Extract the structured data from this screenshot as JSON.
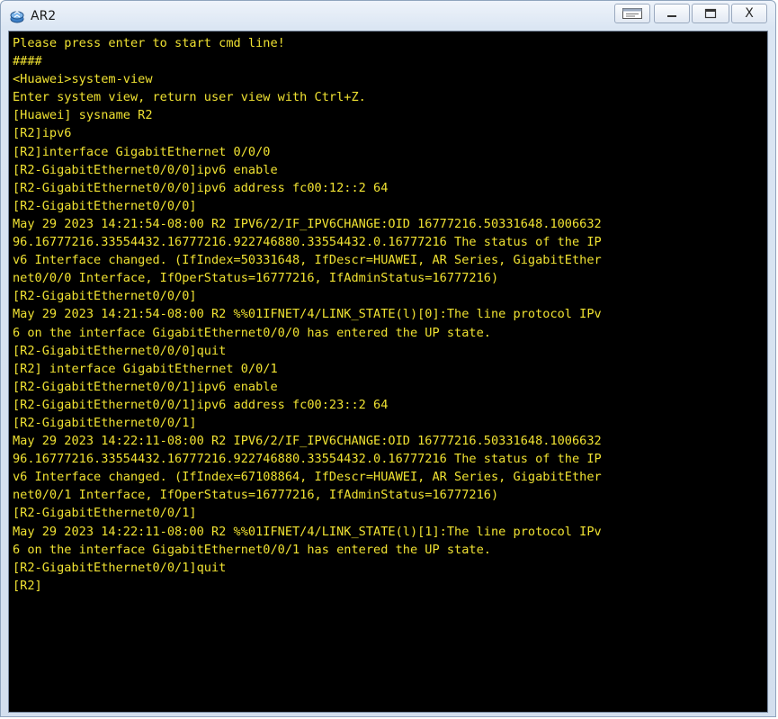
{
  "window": {
    "title": "AR2"
  },
  "controls": {
    "restore_icon": "window-switch-icon",
    "minimize_icon": "minimize-icon",
    "maximize_icon": "maximize-icon",
    "close_label": "X"
  },
  "colors": {
    "terminal_background": "#000000",
    "terminal_text": "#f0e232"
  },
  "terminal": {
    "lines": [
      "Please press enter to start cmd line!",
      "####",
      "<Huawei>system-view",
      "Enter system view, return user view with Ctrl+Z.",
      "[Huawei] sysname R2",
      "[R2]ipv6",
      "[R2]interface GigabitEthernet 0/0/0",
      "[R2-GigabitEthernet0/0/0]ipv6 enable",
      "[R2-GigabitEthernet0/0/0]ipv6 address fc00:12::2 64",
      "[R2-GigabitEthernet0/0/0]",
      "May 29 2023 14:21:54-08:00 R2 IPV6/2/IF_IPV6CHANGE:OID 16777216.50331648.1006632",
      "96.16777216.33554432.16777216.922746880.33554432.0.16777216 The status of the IP",
      "v6 Interface changed. (IfIndex=50331648, IfDescr=HUAWEI, AR Series, GigabitEther",
      "net0/0/0 Interface, IfOperStatus=16777216, IfAdminStatus=16777216)",
      "[R2-GigabitEthernet0/0/0]",
      "May 29 2023 14:21:54-08:00 R2 %%01IFNET/4/LINK_STATE(l)[0]:The line protocol IPv",
      "6 on the interface GigabitEthernet0/0/0 has entered the UP state.",
      "[R2-GigabitEthernet0/0/0]quit",
      "[R2] interface GigabitEthernet 0/0/1",
      "[R2-GigabitEthernet0/0/1]ipv6 enable",
      "[R2-GigabitEthernet0/0/1]ipv6 address fc00:23::2 64",
      "[R2-GigabitEthernet0/0/1]",
      "May 29 2023 14:22:11-08:00 R2 IPV6/2/IF_IPV6CHANGE:OID 16777216.50331648.1006632",
      "96.16777216.33554432.16777216.922746880.33554432.0.16777216 The status of the IP",
      "v6 Interface changed. (IfIndex=67108864, IfDescr=HUAWEI, AR Series, GigabitEther",
      "net0/0/1 Interface, IfOperStatus=16777216, IfAdminStatus=16777216)",
      "[R2-GigabitEthernet0/0/1]",
      "May 29 2023 14:22:11-08:00 R2 %%01IFNET/4/LINK_STATE(l)[1]:The line protocol IPv",
      "6 on the interface GigabitEthernet0/0/1 has entered the UP state.",
      "[R2-GigabitEthernet0/0/1]quit",
      "[R2]"
    ]
  }
}
